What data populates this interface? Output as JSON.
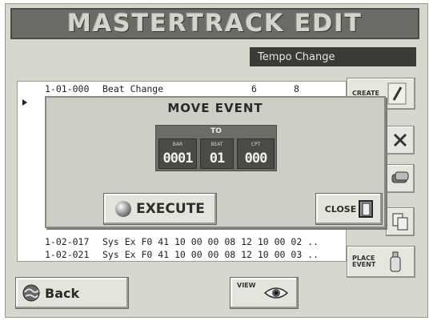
{
  "header": {
    "title": "MASTERTRACK EDIT"
  },
  "filter": {
    "label": "Tempo Change"
  },
  "event_list": {
    "rows": [
      {
        "pos": "1-01-000",
        "type": "Beat Change",
        "v1": "6",
        "v2": "8"
      },
      {
        "pos": "1-02-017",
        "data": "Sys Ex F0 41 10 00 00 08 12 10 00 02 .."
      },
      {
        "pos": "1-02-021",
        "data": "Sys Ex F0 41 10 00 00 08 12 10 00 03 .."
      }
    ]
  },
  "side_buttons": {
    "create_label": "CREATE",
    "place_event_line1": "PLACE",
    "place_event_line2": "EVENT"
  },
  "modal": {
    "title": "MOVE EVENT",
    "to_label": "TO",
    "fields": [
      {
        "label": "BAR",
        "value": "0001"
      },
      {
        "label": "BEAT",
        "value": "01"
      },
      {
        "label": "CPT",
        "value": "000"
      }
    ],
    "execute_label": "EXECUTE",
    "close_label": "CLOSE"
  },
  "bottom": {
    "back_label": "Back",
    "view_label": "VIEW"
  }
}
